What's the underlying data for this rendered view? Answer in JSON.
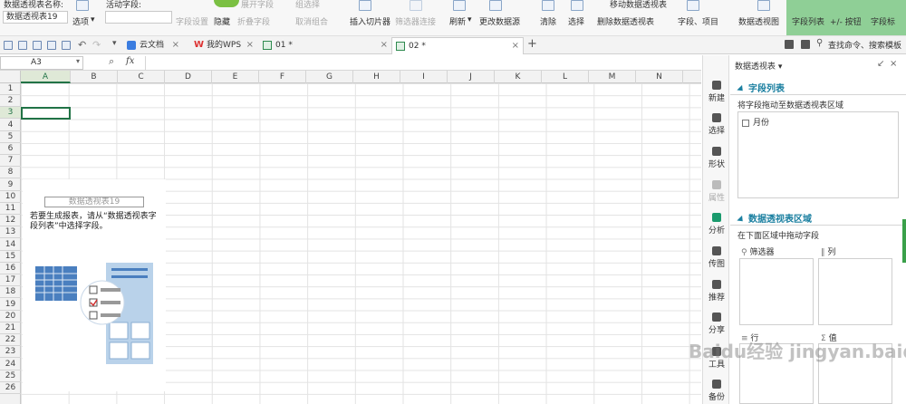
{
  "ribbon": {
    "pivot_name_label": "数据透视表名称:",
    "pivot_name_value": "数据透视表19",
    "options": "选项",
    "active_field_label": "活动字段:",
    "field_settings": "字段设置",
    "hide": "隐藏",
    "expand_field": "展开字段",
    "collapse_field": "折叠字段",
    "group_selection": "组选择",
    "ungroup": "取消组合",
    "insert_slicer": "插入切片器",
    "filter_connections": "筛选器连接",
    "refresh": "刷新",
    "change_source": "更改数据源",
    "clear": "清除",
    "select": "选择",
    "move_pivot": "移动数据透视表",
    "delete_pivot": "删除数据透视表",
    "fields_items": "字段、项目",
    "pivot_chart": "数据透视图",
    "field_list": "字段列表",
    "pm_buttons": "+/- 按钮",
    "field_headers": "字段标"
  },
  "tabs": [
    {
      "label": "云文档"
    },
    {
      "label": "我的WPS"
    },
    {
      "label": "01 *"
    },
    {
      "label": "02 *"
    }
  ],
  "search_placeholder": "查找命令、搜索模板",
  "formula": {
    "namebox": "A3",
    "fx": "fx"
  },
  "columns": [
    "A",
    "B",
    "C",
    "D",
    "E",
    "F",
    "G",
    "H",
    "I",
    "J",
    "K",
    "L",
    "M",
    "N"
  ],
  "rows": [
    "1",
    "2",
    "3",
    "4",
    "5",
    "6",
    "7",
    "8",
    "9",
    "10",
    "11",
    "12",
    "13",
    "14",
    "15",
    "16",
    "17",
    "18",
    "19",
    "20",
    "21",
    "22",
    "23",
    "24",
    "25",
    "26"
  ],
  "pivot_placeholder": {
    "title": "数据透视表19",
    "help": "若要生成报表，请从“数据透视表字段列表”中选择字段。"
  },
  "sidebar": [
    {
      "label": "新建"
    },
    {
      "label": "选择"
    },
    {
      "label": "形状"
    },
    {
      "label": "属性"
    },
    {
      "label": "分析"
    },
    {
      "label": "传图"
    },
    {
      "label": "推荐"
    },
    {
      "label": "分享"
    },
    {
      "label": "工具"
    },
    {
      "label": "备份"
    }
  ],
  "panel": {
    "header": "数据透视表 ▾",
    "field_list_title": "字段列表",
    "field_list_hint": "将字段拖动至数据透视表区域",
    "fields": [
      "月份"
    ],
    "areas_title": "数据透视表区域",
    "areas_hint": "在下面区域中拖动字段",
    "filter_label": "筛选器",
    "column_label": "列",
    "row_label": "行",
    "value_label": "值"
  },
  "watermark": "Baidu经验 jingyan.baidu.com",
  "colors": {
    "accent_green": "#217346",
    "panel_accent": "#1a7fa0",
    "active_tab_green": "#3aa04a"
  }
}
